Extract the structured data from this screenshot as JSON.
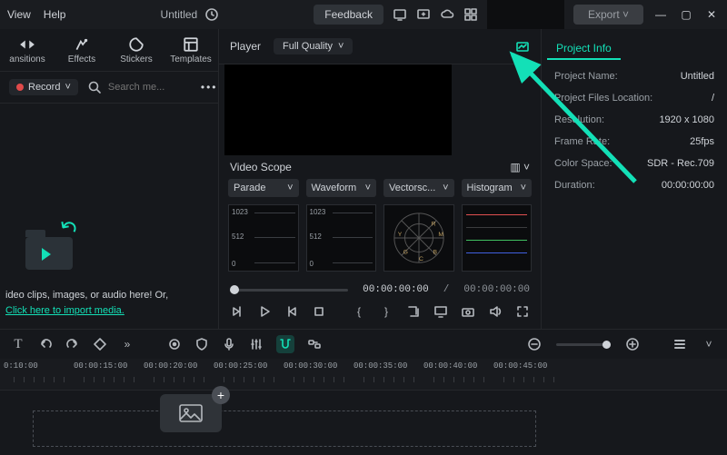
{
  "menubar": {
    "view": "View",
    "help": "Help"
  },
  "title": "Untitled",
  "topbar": {
    "feedback": "Feedback",
    "export": "Export"
  },
  "media_tabs": {
    "transitions": "ansitions",
    "effects": "Effects",
    "stickers": "Stickers",
    "templates": "Templates"
  },
  "media_toolbar": {
    "record": "Record",
    "search_placeholder": "Search me..."
  },
  "import": {
    "line1": "ideo clips, images, or audio here! Or,",
    "link": "Click here to import media."
  },
  "player": {
    "label": "Player",
    "quality": "Full Quality"
  },
  "scope": {
    "title": "Video Scope",
    "sel": {
      "parade": "Parade",
      "waveform": "Waveform",
      "vectorscope": "Vectorsc...",
      "histogram": "Histogram"
    },
    "yticks": {
      "a": "1023",
      "b": "512",
      "c": "0"
    }
  },
  "transport": {
    "pos": "00:00:00:00",
    "sep": "/",
    "dur": "00:00:00:00"
  },
  "project_info": {
    "tab": "Project Info",
    "rows": {
      "name": {
        "label": "Project Name:",
        "value": "Untitled"
      },
      "loc": {
        "label": "Project Files Location:",
        "value": "/"
      },
      "res": {
        "label": "Resolution:",
        "value": "1920 x 1080"
      },
      "fps": {
        "label": "Frame Rate:",
        "value": "25fps"
      },
      "cs": {
        "label": "Color Space:",
        "value": "SDR - Rec.709"
      },
      "dur": {
        "label": "Duration:",
        "value": "00:00:00:00"
      }
    }
  },
  "ruler": [
    "0:10:00",
    "00:00:15:00",
    "00:00:20:00",
    "00:00:25:00",
    "00:00:30:00",
    "00:00:35:00",
    "00:00:40:00",
    "00:00:45:00"
  ]
}
